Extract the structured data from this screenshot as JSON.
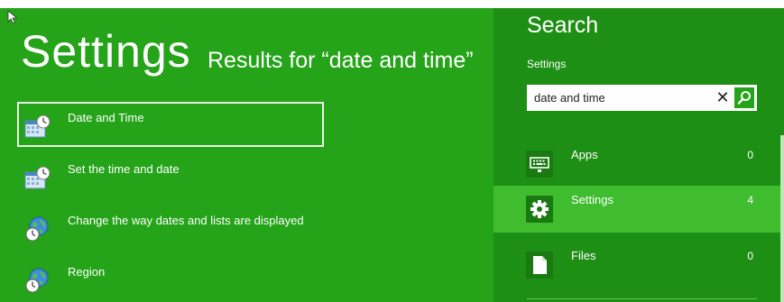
{
  "header": {
    "title": "Settings",
    "subtitle": "Results for “date and time”"
  },
  "results": [
    {
      "label": "Date and Time",
      "icon": "date-time-icon",
      "selected": true
    },
    {
      "label": "Set the time and date",
      "icon": "date-time-icon",
      "selected": false
    },
    {
      "label": "Change the way dates and lists are displayed",
      "icon": "region-globe-icon",
      "selected": false
    },
    {
      "label": "Region",
      "icon": "region-globe-icon",
      "selected": false
    }
  ],
  "search": {
    "title": "Search",
    "scope": "Settings",
    "value": "date and time",
    "clear_glyph": "✕",
    "search_icon": "search-icon"
  },
  "scopes": [
    {
      "label": "Apps",
      "count": "0",
      "icon": "keyboard-icon",
      "selected": false
    },
    {
      "label": "Settings",
      "count": "4",
      "icon": "gear-icon",
      "selected": true
    },
    {
      "label": "Files",
      "count": "0",
      "icon": "file-icon",
      "selected": false
    }
  ],
  "colors": {
    "background": "#25a319",
    "charm_bar": "#1e8f15",
    "selected_scope": "#3fbd2e"
  }
}
